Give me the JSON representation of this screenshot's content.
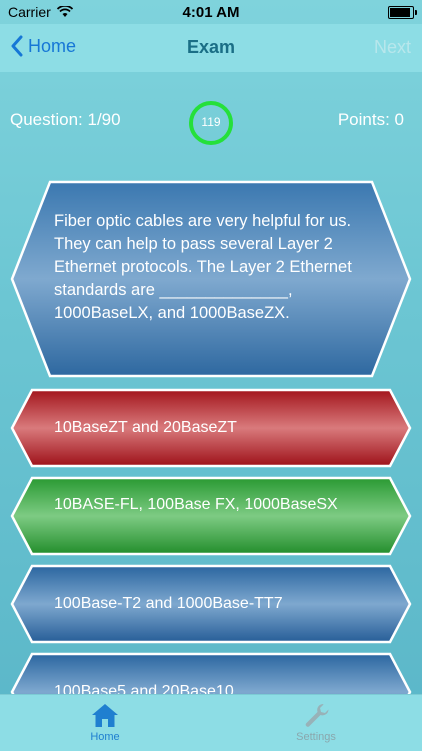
{
  "status": {
    "carrier": "Carrier",
    "time": "4:01 AM"
  },
  "nav": {
    "back_label": "Home",
    "title": "Exam",
    "next_label": "Next"
  },
  "exam": {
    "question_label": "Question: 1/90",
    "points_label": "Points: 0",
    "timer": "119"
  },
  "question": {
    "text": "Fiber optic cables are very helpful for us. They can help to pass several Layer 2 Ethernet protocols. The Layer 2 Ethernet standards are ______________, 1000BaseLX, and 1000BaseZX."
  },
  "answers": [
    {
      "label": "10BaseZT and 20BaseZT",
      "state": "incorrect",
      "color": "#b3282e"
    },
    {
      "label": "10BASE-FL, 100Base FX, 1000BaseSX",
      "state": "correct",
      "color": "#2f9e3a"
    },
    {
      "label": "100Base-T2 and 1000Base-TT7",
      "state": "neutral",
      "color": "#2f6ea6"
    },
    {
      "label": "100Base5 and 20Base10",
      "state": "neutral",
      "color": "#2f6ea6"
    }
  ],
  "tabs": [
    {
      "label": "Home",
      "icon": "home-icon",
      "active": true
    },
    {
      "label": "Settings",
      "icon": "wrench-icon",
      "active": false
    }
  ],
  "colors": {
    "accent": "#1677d6",
    "timer_ring": "#25e03a",
    "card_blue": "#2f6ea6"
  }
}
